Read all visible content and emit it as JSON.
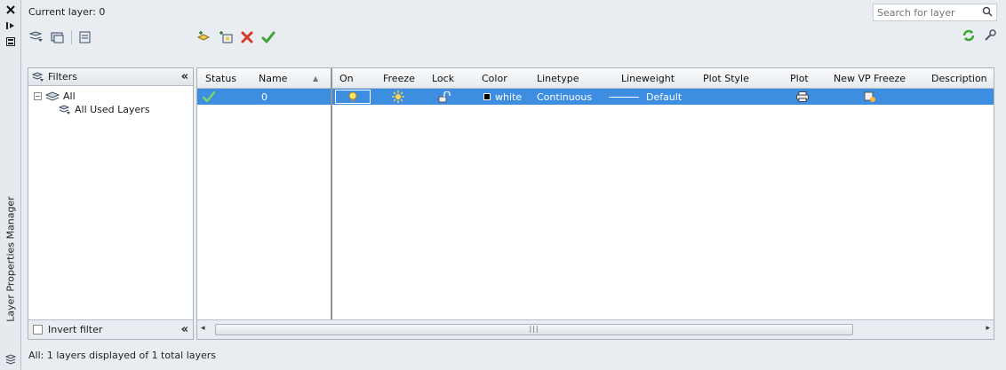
{
  "sidebar": {
    "title": "Layer Properties Manager",
    "close_icon": "close-icon",
    "autohide_icon": "autohide-icon",
    "properties_icon": "properties-icon"
  },
  "header": {
    "current_layer_text": "Current layer: 0",
    "search_placeholder": "Search for layer"
  },
  "filters": {
    "header_label": "Filters",
    "tree": [
      {
        "label": "All"
      },
      {
        "label": "All Used Layers"
      }
    ],
    "invert_filter_label": "Invert filter"
  },
  "grid": {
    "columns": [
      "Status",
      "Name",
      "On",
      "Freeze",
      "Lock",
      "Color",
      "Linetype",
      "Lineweight",
      "Plot Style",
      "Plot",
      "New VP Freeze",
      "Description"
    ],
    "rows": [
      {
        "status": "current",
        "name": "0",
        "on": "lightbulb-on",
        "freeze": "sun",
        "lock": "unlocked",
        "color": "white",
        "linetype": "Continuous",
        "lineweight": "Default",
        "plot_style": "",
        "plot": "printer",
        "new_vp_freeze": "vp-thaw"
      }
    ]
  },
  "statusbar": {
    "text": "All: 1 layers displayed of 1 total layers"
  },
  "colors": {
    "selection": "#3d8de0",
    "panel_bg": "#e9edf2",
    "check_green": "#3aa52f",
    "delete_red": "#d23a2a"
  }
}
